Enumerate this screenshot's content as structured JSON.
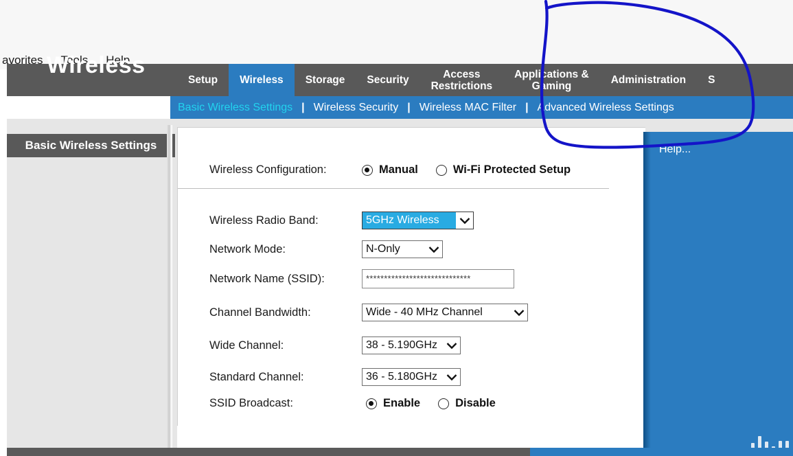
{
  "browser": {
    "menu_items": [
      "avorites",
      "Tools",
      "Help"
    ]
  },
  "router": {
    "page_heading": "Wireless",
    "tabs": [
      {
        "label": "Setup",
        "active": false
      },
      {
        "label": "Wireless",
        "active": true
      },
      {
        "label": "Storage",
        "active": false
      },
      {
        "label": "Security",
        "active": false
      },
      {
        "label": "Access\nRestrictions",
        "active": false
      },
      {
        "label": "Applications &\nGaming",
        "active": false
      },
      {
        "label": "Administration",
        "active": false
      },
      {
        "label": "S",
        "active": false
      }
    ],
    "subnav": {
      "items": [
        {
          "label": "Basic Wireless Settings",
          "current": true
        },
        {
          "label": "Wireless Security",
          "current": false
        },
        {
          "label": "Wireless MAC Filter",
          "current": false
        },
        {
          "label": "Advanced Wireless Settings",
          "current": false
        }
      ],
      "separator": "|"
    },
    "section_title": "Basic Wireless Settings"
  },
  "form": {
    "wireless_configuration": {
      "label": "Wireless Configuration:",
      "options": [
        {
          "label": "Manual",
          "checked": true
        },
        {
          "label": "Wi-Fi Protected Setup",
          "checked": false
        }
      ]
    },
    "wireless_radio_band": {
      "label": "Wireless Radio Band:",
      "value": "5GHz Wireless",
      "focused": true
    },
    "network_mode": {
      "label": "Network Mode:",
      "value": "N-Only",
      "focused": false
    },
    "network_name": {
      "label": "Network Name (SSID):",
      "value": "*****************************",
      "placeholder": ""
    },
    "channel_bandwidth": {
      "label": "Channel Bandwidth:",
      "value": "Wide - 40 MHz Channel",
      "focused": false
    },
    "wide_channel": {
      "label": "Wide Channel:",
      "value": "38 - 5.190GHz",
      "focused": false
    },
    "standard_channel": {
      "label": "Standard Channel:",
      "value": "36 - 5.180GHz",
      "focused": false
    },
    "ssid_broadcast": {
      "label": "SSID Broadcast:",
      "options": [
        {
          "label": "Enable",
          "checked": true
        },
        {
          "label": "Disable",
          "checked": false
        }
      ]
    }
  },
  "help": {
    "link_label": "Help...",
    "logo_name": "cisco-logo"
  },
  "colors": {
    "accent_blue": "#2b7cc0",
    "header_gray": "#595959",
    "current_link_cyan": "#22d3ee",
    "select_highlight": "#29abe2",
    "annotation_ink": "#1414c8"
  }
}
